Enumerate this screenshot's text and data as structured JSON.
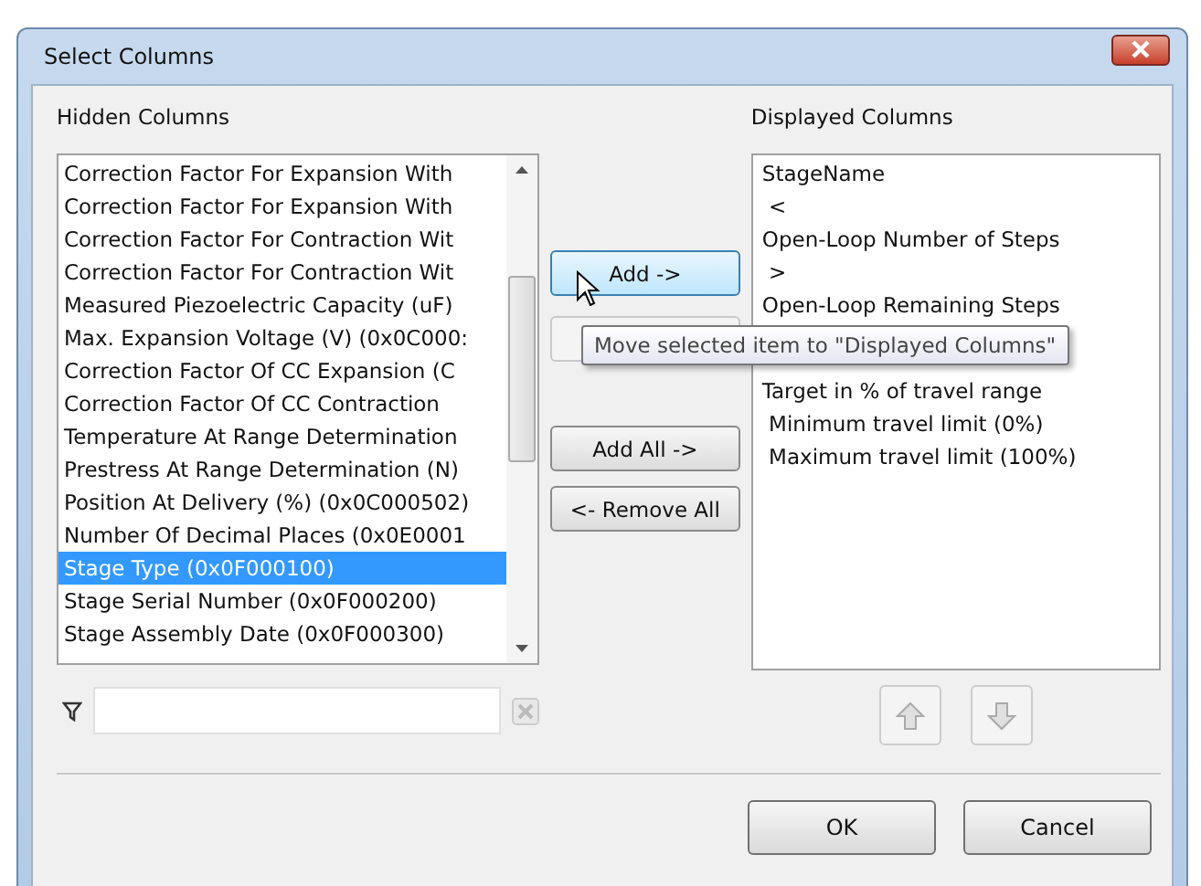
{
  "window": {
    "title": "Select Columns"
  },
  "hidden_columns": {
    "label": "Hidden Columns",
    "items": [
      {
        "text": "Correction Factor For Expansion With",
        "selected": false
      },
      {
        "text": "Correction Factor For Expansion With",
        "selected": false
      },
      {
        "text": "Correction Factor For Contraction Wit",
        "selected": false
      },
      {
        "text": "Correction Factor For Contraction Wit",
        "selected": false
      },
      {
        "text": "Measured Piezoelectric Capacity (uF)",
        "selected": false
      },
      {
        "text": "Max. Expansion Voltage (V)  (0x0C000:",
        "selected": false
      },
      {
        "text": "Correction Factor Of CC Expansion  (C",
        "selected": false
      },
      {
        "text": "Correction Factor Of CC Contraction",
        "selected": false
      },
      {
        "text": "Temperature At Range Determination",
        "selected": false
      },
      {
        "text": "Prestress At Range Determination (N)",
        "selected": false
      },
      {
        "text": "Position At Delivery (%)  (0x0C000502)",
        "selected": false
      },
      {
        "text": "Number Of Decimal Places  (0x0E0001",
        "selected": false
      },
      {
        "text": "Stage Type  (0x0F000100)",
        "selected": true
      },
      {
        "text": "Stage Serial Number  (0x0F000200)",
        "selected": false
      },
      {
        "text": "Stage Assembly Date  (0x0F000300)",
        "selected": false
      }
    ]
  },
  "buttons": [
    {
      "label": "Add ->",
      "kind": "hover"
    },
    {
      "kind": "disabled"
    },
    {
      "label": "Add All ->",
      "kind": "normal"
    },
    {
      "label": "<- Remove All",
      "kind": "normal"
    }
  ],
  "tooltip": "Move selected item to \"Displayed Columns\"",
  "displayed_columns": {
    "label": "Displayed Columns",
    "items": [
      {
        "text": "StageName"
      },
      {
        "text": " <"
      },
      {
        "text": "Open-Loop Number of Steps"
      },
      {
        "text": " >"
      },
      {
        "text": "Open-Loop Remaining Steps"
      },
      {
        "text": "Target in % of travel range"
      },
      {
        "text": " Minimum travel limit (0%)"
      },
      {
        "text": " Maximum travel limit (100%)"
      }
    ]
  },
  "footer_buttons": [
    "OK",
    "Cancel"
  ]
}
